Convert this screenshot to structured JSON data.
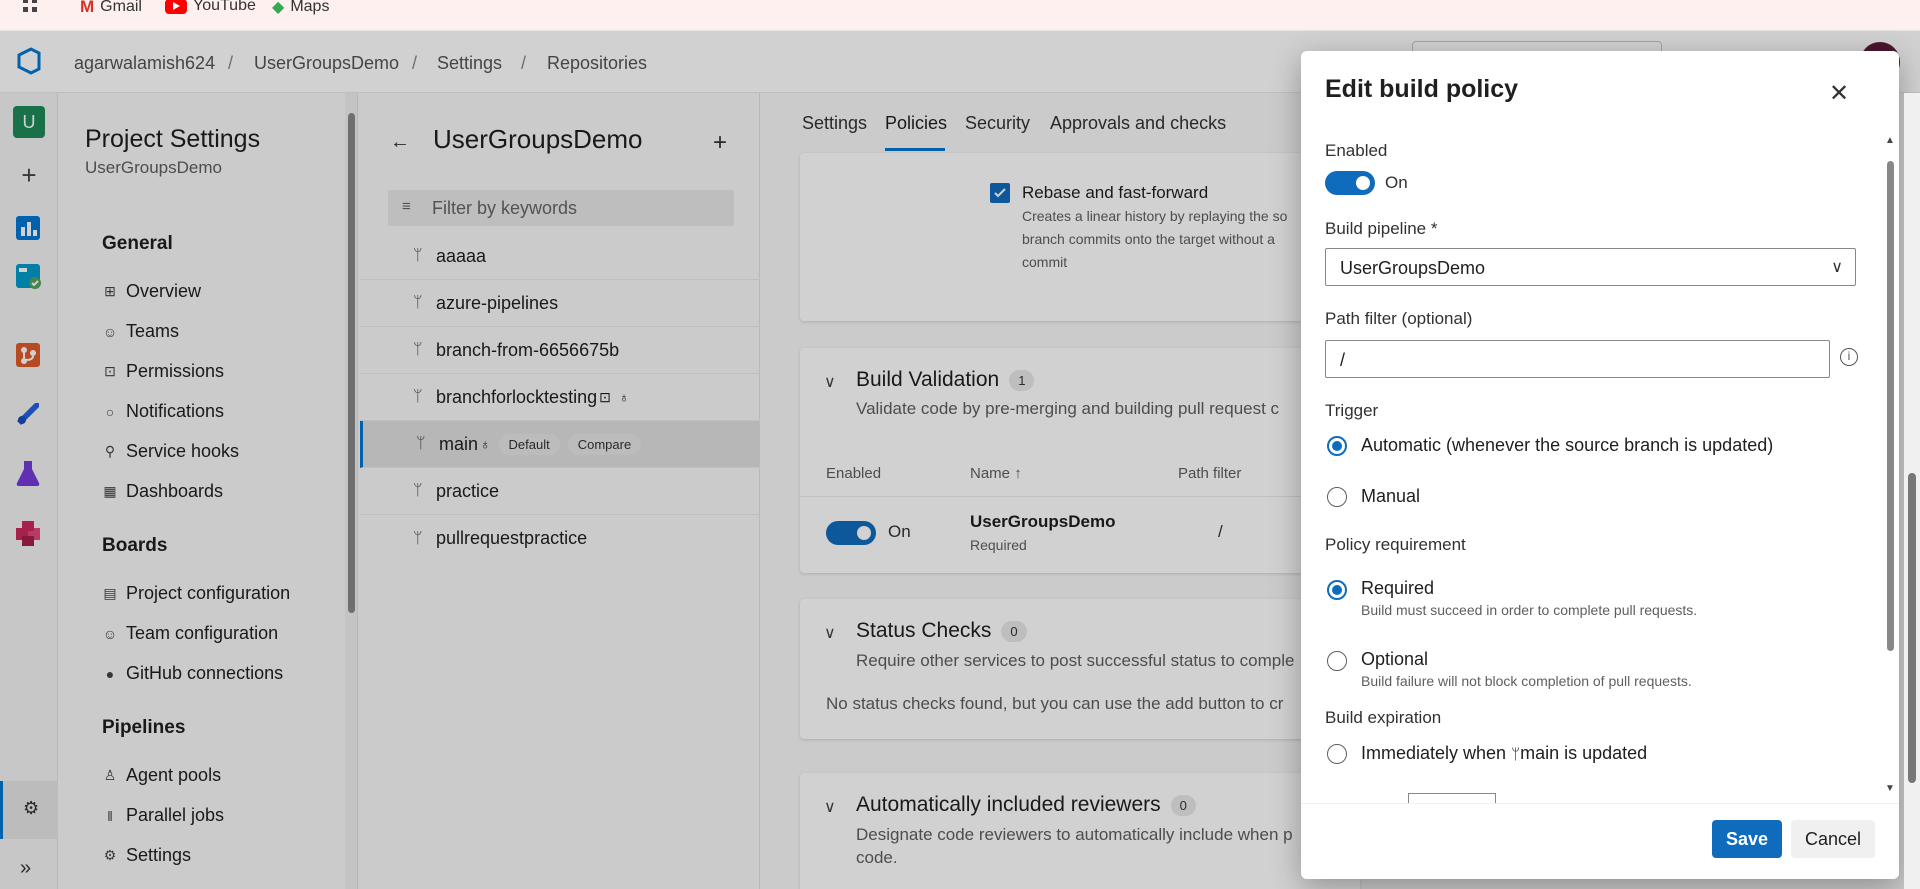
{
  "bookmarks": [
    {
      "label": "Gmail"
    },
    {
      "label": "YouTube"
    },
    {
      "label": "Maps"
    }
  ],
  "breadcrumb": {
    "org": "agarwalamish624",
    "project": "UserGroupsDemo",
    "section": "Settings",
    "page": "Repositories",
    "sep": "/"
  },
  "rail": {
    "avatar_letter": "U"
  },
  "nav": {
    "title": "Project Settings",
    "subtitle": "UserGroupsDemo",
    "general_header": "General",
    "general": [
      "Overview",
      "Teams",
      "Permissions",
      "Notifications",
      "Service hooks",
      "Dashboards"
    ],
    "boards_header": "Boards",
    "boards": [
      "Project configuration",
      "Team configuration",
      "GitHub connections"
    ],
    "pipelines_header": "Pipelines",
    "pipelines": [
      "Agent pools",
      "Parallel jobs",
      "Settings"
    ]
  },
  "repos": {
    "title": "UserGroupsDemo",
    "filter_placeholder": "Filter by keywords",
    "branches": [
      {
        "name": "aaaaa"
      },
      {
        "name": "azure-pipelines"
      },
      {
        "name": "branch-from-6656675b"
      },
      {
        "name": "branchforlocktesting"
      },
      {
        "name": "main",
        "badges": [
          "Default",
          "Compare"
        ],
        "selected": true
      },
      {
        "name": "practice"
      },
      {
        "name": "pullrequestpractice"
      }
    ]
  },
  "tabs": [
    "Settings",
    "Policies",
    "Security",
    "Approvals and checks"
  ],
  "active_tab": "Policies",
  "merge": {
    "option": "Rebase and fast-forward",
    "desc1": "Creates a linear history by replaying the so",
    "desc2": "branch commits onto the target without a",
    "desc3": "commit"
  },
  "build_validation": {
    "title": "Build Validation",
    "count": "1",
    "desc": "Validate code by pre-merging and building pull request c",
    "col_enabled": "Enabled",
    "col_name": "Name",
    "col_sort": "↑",
    "col_path": "Path filter",
    "row": {
      "toggle": "On",
      "name": "UserGroupsDemo",
      "sub": "Required",
      "path": "/"
    }
  },
  "status_checks": {
    "title": "Status Checks",
    "count": "0",
    "desc": "Require other services to post successful status to comple",
    "empty": "No status checks found, but you can use the add button to cr"
  },
  "reviewers": {
    "title": "Automatically included reviewers",
    "count": "0",
    "desc1": "Designate code reviewers to automatically include when p",
    "desc2": "code."
  },
  "panel": {
    "title": "Edit build policy",
    "enabled_label": "Enabled",
    "enabled_state": "On",
    "pipeline_label": "Build pipeline *",
    "pipeline_value": "UserGroupsDemo",
    "path_label": "Path filter (optional)",
    "path_value": "/",
    "trigger_label": "Trigger",
    "trigger_auto": "Automatic (whenever the source branch is updated)",
    "trigger_manual": "Manual",
    "req_label": "Policy requirement",
    "req_required": "Required",
    "req_required_sub": "Build must succeed in order to complete pull requests.",
    "req_optional": "Optional",
    "req_optional_sub": "Build failure will not block completion of pull requests.",
    "expiration_label": "Build expiration",
    "expiration_immediate_pre": "Immediately when",
    "expiration_immediate_branch": "main is updated",
    "save": "Save",
    "cancel": "Cancel"
  },
  "colors": {
    "accent": "#0f6cbd",
    "azure": "#0078d4"
  }
}
